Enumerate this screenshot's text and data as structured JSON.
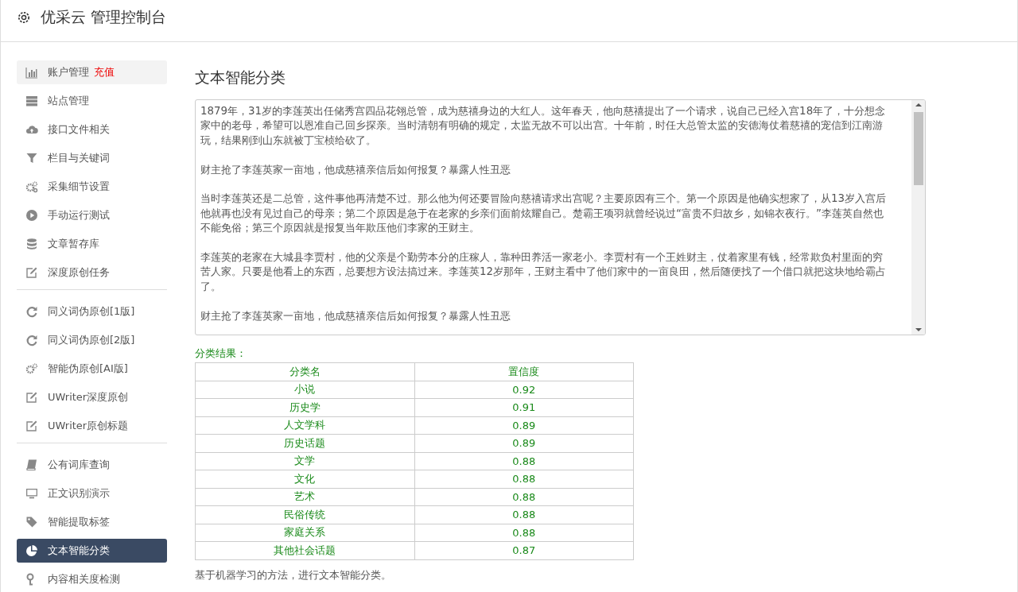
{
  "header": {
    "title": "优采云 管理控制台"
  },
  "sidebar": {
    "groups": [
      {
        "items": [
          {
            "label": "账户管理",
            "link": "充值",
            "highlighted": true,
            "selected": false
          },
          {
            "label": "站点管理",
            "highlighted": false,
            "selected": false
          },
          {
            "label": "接口文件相关",
            "highlighted": false,
            "selected": false
          },
          {
            "label": "栏目与关键词",
            "highlighted": false,
            "selected": false
          },
          {
            "label": "采集细节设置",
            "highlighted": false,
            "selected": false
          },
          {
            "label": "手动运行测试",
            "highlighted": false,
            "selected": false
          },
          {
            "label": "文章暂存库",
            "highlighted": false,
            "selected": false
          },
          {
            "label": "深度原创任务",
            "highlighted": false,
            "selected": false
          }
        ]
      },
      {
        "items": [
          {
            "label": "同义词伪原创[1版]",
            "highlighted": false,
            "selected": false
          },
          {
            "label": "同义词伪原创[2版]",
            "highlighted": false,
            "selected": false
          },
          {
            "label": "智能伪原创[AI版]",
            "highlighted": false,
            "selected": false
          },
          {
            "label": "UWriter深度原创",
            "highlighted": false,
            "selected": false
          },
          {
            "label": "UWriter原创标题",
            "highlighted": false,
            "selected": false
          }
        ]
      },
      {
        "items": [
          {
            "label": "公有词库查询",
            "highlighted": false,
            "selected": false
          },
          {
            "label": "正文识别演示",
            "highlighted": false,
            "selected": false
          },
          {
            "label": "智能提取标签",
            "highlighted": false,
            "selected": false
          },
          {
            "label": "文本智能分类",
            "highlighted": false,
            "selected": true
          },
          {
            "label": "内容相关度检测",
            "highlighted": false,
            "selected": false
          }
        ]
      }
    ]
  },
  "main": {
    "title": "文本智能分类",
    "text_input": {
      "paragraphs": [
        "1879年，31岁的李莲英出任储秀宫四品花翎总管，成为慈禧身边的大红人。这年春天，他向慈禧提出了一个请求，说自己已经入宫18年了，十分想念家中的老母，希望可以恩准自己回乡探亲。当时清朝有明确的规定，太监无故不可以出宫。十年前，时任大总管太监的安德海仗着慈禧的宠信到江南游玩，结果刚到山东就被丁宝桢给砍了。",
        "财主抢了李莲英家一亩地，他成慈禧亲信后如何报复？暴露人性丑恶",
        "当时李莲英还是二总管，这件事他再清楚不过。那么他为何还要冒险向慈禧请求出宫呢？主要原因有三个。第一个原因是他确实想家了，从13岁入宫后他就再也没有见过自己的母亲；第二个原因是急于在老家的乡亲们面前炫耀自己。楚霸王项羽就曾经说过“富贵不归故乡，如锦衣夜行。”李莲英自然也不能免俗；第三个原因就是报复当年欺压他们李家的王财主。",
        "李莲英的老家在大城县李贾村，他的父亲是个勤劳本分的庄稼人，靠种田养活一家老小。李贾村有一个王姓财主，仗着家里有钱，经常欺负村里面的穷苦人家。只要是他看上的东西，总要想方设法搞过来。李莲英12岁那年，王财主看中了他们家中的一亩良田，然后随便找了一个借口就把这块地给霸占了。",
        "财主抢了李莲英家一亩地，他成慈禧亲信后如何报复？暴露人性丑恶"
      ]
    },
    "result_label": "分类结果：",
    "table": {
      "columns": [
        "分类名",
        "置信度"
      ],
      "rows": [
        [
          "小说",
          "0.92"
        ],
        [
          "历史学",
          "0.91"
        ],
        [
          "人文学科",
          "0.89"
        ],
        [
          "历史话题",
          "0.89"
        ],
        [
          "文学",
          "0.88"
        ],
        [
          "文化",
          "0.88"
        ],
        [
          "艺术",
          "0.88"
        ],
        [
          "民俗传统",
          "0.88"
        ],
        [
          "家庭关系",
          "0.88"
        ],
        [
          "其他社会话题",
          "0.87"
        ]
      ]
    },
    "note": "基于机器学习的方法，进行文本智能分类。"
  }
}
